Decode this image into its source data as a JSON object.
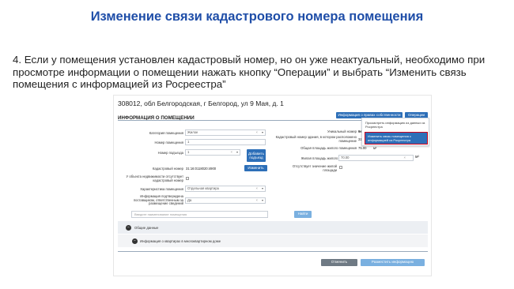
{
  "slide": {
    "title": "Изменение связи кадастрового номера помещения",
    "text": "4. Если у помещения установлен кадастровый номер, но он уже неактуальный, необходимо при просмотре информации о помещении нажать кнопку “Операции” и выбрать “Изменить связь помещения с информацией из Росреестра”"
  },
  "screen": {
    "address": "308012, обл Белгородская, г Белгород, ул 9 Мая, д. 1",
    "section": "ИНФОРМАЦИЯ О ПОМЕЩЕНИИ",
    "btn_rights": "Информация о правах собственности",
    "btn_ops": "Операции",
    "menu_item1": "Просмотреть информацию из данных из Росреестра",
    "menu_item2": "Изменить связь помещения с информацией из Росреестра",
    "left": {
      "cat_label": "Категория помещения",
      "cat_value": "Жилое",
      "num_label": "Номер помещения",
      "num_value": "1",
      "entr_label": "Номер подъезда",
      "entr_value": "1",
      "add_entr": "Добавить подъезд",
      "cad_label": "Кадастровый номер",
      "cad_value": "31:16:0118020:4900",
      "change_btn": "Изменить",
      "no_cad_label": "У объекта недвижимости отсутствует кадастровый номер",
      "char_label": "Характеристика помещения",
      "char_value": "Отдельная квартира",
      "info_label": "Информация подтверждена поставщиком, ответственным за размещение сведений",
      "info_value": "Да"
    },
    "right": {
      "uid_label": "Уникальный номер",
      "uid_value": "9ed4f...",
      "bldg_cad_label": "Кадастровый номер здания, в котором расположено помещение",
      "bldg_cad_value": "31:16:0118020:…",
      "total_area_label": "Общая площадь жилого помещения",
      "total_area_value": "75.00",
      "unit": "м²",
      "living_area_label": "Жилая площадь жилого помещения",
      "living_area_value": "70.00",
      "no_living_label": "Отсутствует значение жилой площади"
    },
    "search_placeholder": "Введите наименование помещения",
    "find_btn": "Найти",
    "band1": "Общие данные",
    "band2": "Информация о квартирах в многоквартирном доме",
    "cancel_btn": "Отменить",
    "publish_btn": "Разместить информацию"
  }
}
